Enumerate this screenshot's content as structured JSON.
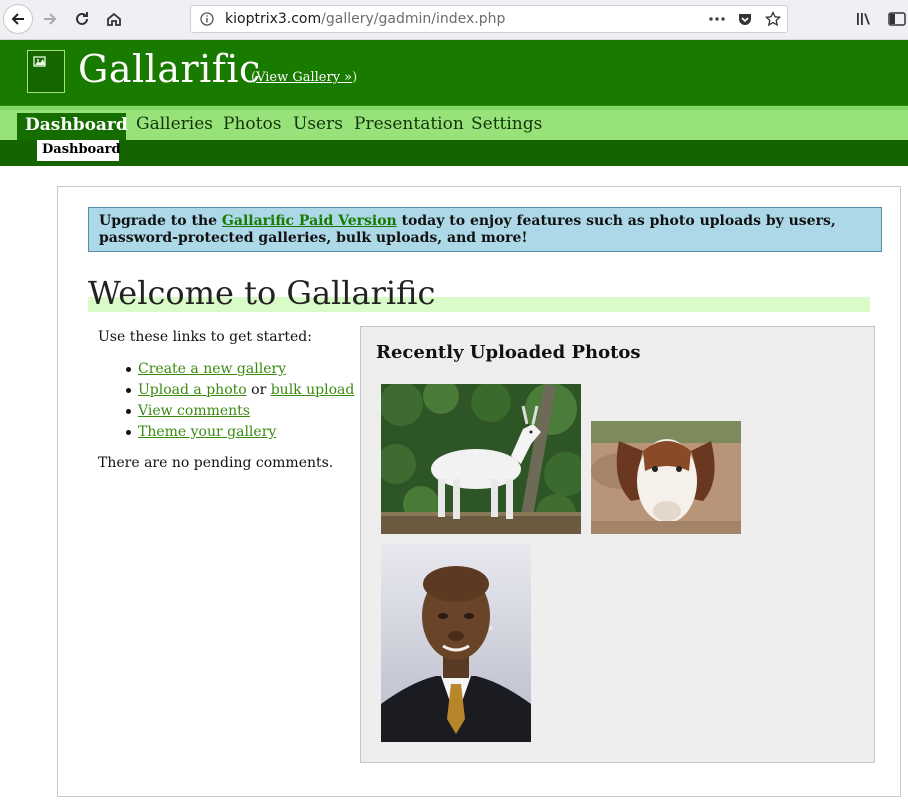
{
  "browser": {
    "url_host": "kioptrix3.com",
    "url_path": "/gallery/gadmin/index.php"
  },
  "header": {
    "title": "Gallarific",
    "view_gallery_label": "View Gallery »",
    "view_gallery_open": "(",
    "view_gallery_close": ")"
  },
  "nav": {
    "active": "Dashboard",
    "items": [
      "Galleries",
      "Photos",
      "Users",
      "Presentation",
      "Settings"
    ],
    "sub_active": "Dashboard"
  },
  "upgrade": {
    "prefix": "Upgrade to the ",
    "link": "Gallarific Paid Version",
    "suffix": " today to enjoy features such as photo uploads by users, password-protected galleries, bulk uploads, and more!"
  },
  "main": {
    "heading": "Welcome to Gallarific",
    "intro": "Use these links to get started:",
    "links": {
      "create_gallery": "Create a new gallery",
      "upload_photo": "Upload a photo",
      "or": " or ",
      "bulk_upload": "bulk upload",
      "view_comments": "View comments",
      "theme_gallery": "Theme your gallery"
    },
    "pending": "There are no pending comments."
  },
  "recent": {
    "title": "Recently Uploaded Photos"
  },
  "colors": {
    "header_green": "#197a00",
    "nav_light_green": "#98e27a",
    "link_green": "#3a8a10",
    "upgrade_blue": "#acd8e8"
  }
}
